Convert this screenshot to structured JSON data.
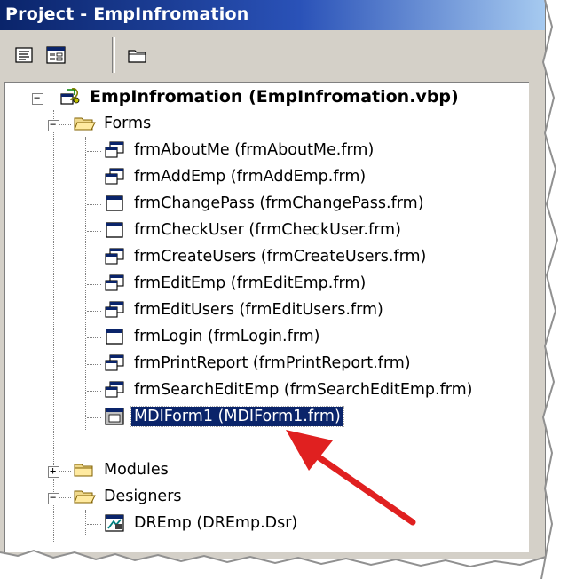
{
  "window": {
    "title": "Project - EmpInfromation"
  },
  "toolbar": {
    "buttons": [
      {
        "icon": "view-code-icon"
      },
      {
        "icon": "view-object-icon"
      },
      {
        "icon": "toggle-folders-icon"
      }
    ]
  },
  "tree": {
    "project": {
      "label": "EmpInfromation (EmpInfromation.vbp)"
    },
    "forms_folder": {
      "label": "Forms"
    },
    "forms": [
      {
        "label": "frmAboutMe (frmAboutMe.frm)",
        "icon": "mdichild-form-icon"
      },
      {
        "label": "frmAddEmp (frmAddEmp.frm)",
        "icon": "mdichild-form-icon"
      },
      {
        "label": "frmChangePass (frmChangePass.frm)",
        "icon": "form-icon"
      },
      {
        "label": "frmCheckUser (frmCheckUser.frm)",
        "icon": "form-icon"
      },
      {
        "label": "frmCreateUsers (frmCreateUsers.frm)",
        "icon": "mdichild-form-icon"
      },
      {
        "label": "frmEditEmp (frmEditEmp.frm)",
        "icon": "mdichild-form-icon"
      },
      {
        "label": "frmEditUsers (frmEditUsers.frm)",
        "icon": "mdichild-form-icon"
      },
      {
        "label": "frmLogin (frmLogin.frm)",
        "icon": "form-icon"
      },
      {
        "label": "frmPrintReport (frmPrintReport.frm)",
        "icon": "mdichild-form-icon"
      },
      {
        "label": "frmSearchEditEmp (frmSearchEditEmp.frm)",
        "icon": "mdichild-form-icon"
      },
      {
        "label": "MDIForm1 (MDIForm1.frm)",
        "icon": "mdi-form-icon",
        "selected": true
      }
    ],
    "modules_folder": {
      "label": "Modules"
    },
    "designers_folder": {
      "label": "Designers"
    },
    "designers": [
      {
        "label": "DREmp (DREmp.Dsr)",
        "icon": "data-report-icon"
      }
    ]
  },
  "annotation": {
    "icon": "red-arrow-icon",
    "color": "#e02020"
  },
  "colors": {
    "titlebar": "#0a246a",
    "selection": "#0a246a",
    "chrome": "#d4d0c8"
  }
}
